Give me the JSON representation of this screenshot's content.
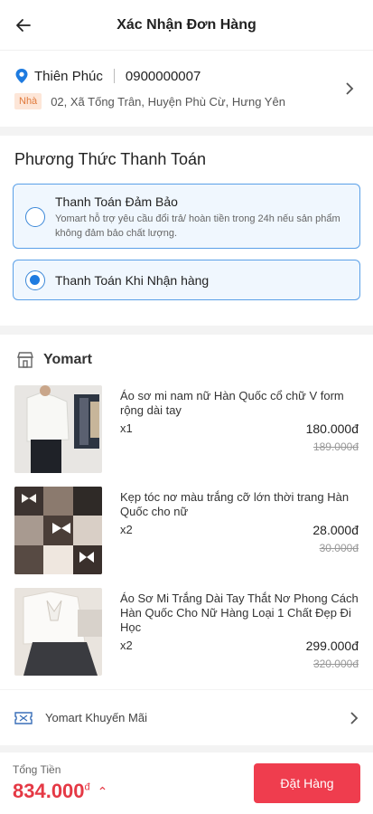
{
  "header": {
    "title": "Xác Nhận Đơn Hàng",
    "back_icon": "arrow-left-icon"
  },
  "address": {
    "name": "Thiên Phúc",
    "phone": "0900000007",
    "tag": "Nhà",
    "line": "02, Xã  Tống Trân, Huyện Phù Cừ, Hưng Yên"
  },
  "payment": {
    "section_title": "Phương Thức Thanh Toán",
    "options": [
      {
        "title": "Thanh Toán Đảm Bảo",
        "desc": "Yomart hỗ trợ yêu cầu đổi trả/ hoàn tiền trong 24h nếu sản phẩm không đảm bảo chất lượng.",
        "selected": false
      },
      {
        "title": "Thanh Toán Khi Nhận hàng",
        "selected": true
      }
    ]
  },
  "shop": {
    "name": "Yomart",
    "products": [
      {
        "name": "Áo sơ mi nam nữ Hàn Quốc cổ chữ V form rộng dài tay",
        "qty": "x1",
        "price": "180.000đ",
        "old_price": "189.000đ"
      },
      {
        "name": "Kẹp tóc nơ màu trắng cỡ lớn thời trang Hàn Quốc cho nữ",
        "qty": "x2",
        "price": "28.000đ",
        "old_price": "30.000đ"
      },
      {
        "name": "Áo Sơ Mi Trắng Dài Tay Thắt Nơ Phong Cách Hàn Quốc Cho Nữ Hàng Loại 1 Chất Đẹp Đi Học",
        "qty": "x2",
        "price": "299.000đ",
        "old_price": "320.000đ"
      }
    ]
  },
  "promo": {
    "label": "Yomart Khuyến Mãi"
  },
  "footer": {
    "total_label": "Tổng Tiền",
    "total_value": "834.000",
    "currency": "đ",
    "order_button": "Đặt Hàng"
  },
  "colors": {
    "accent_blue": "#1e7be0",
    "accent_red": "#ef3d4e",
    "price_red": "#e53945"
  }
}
